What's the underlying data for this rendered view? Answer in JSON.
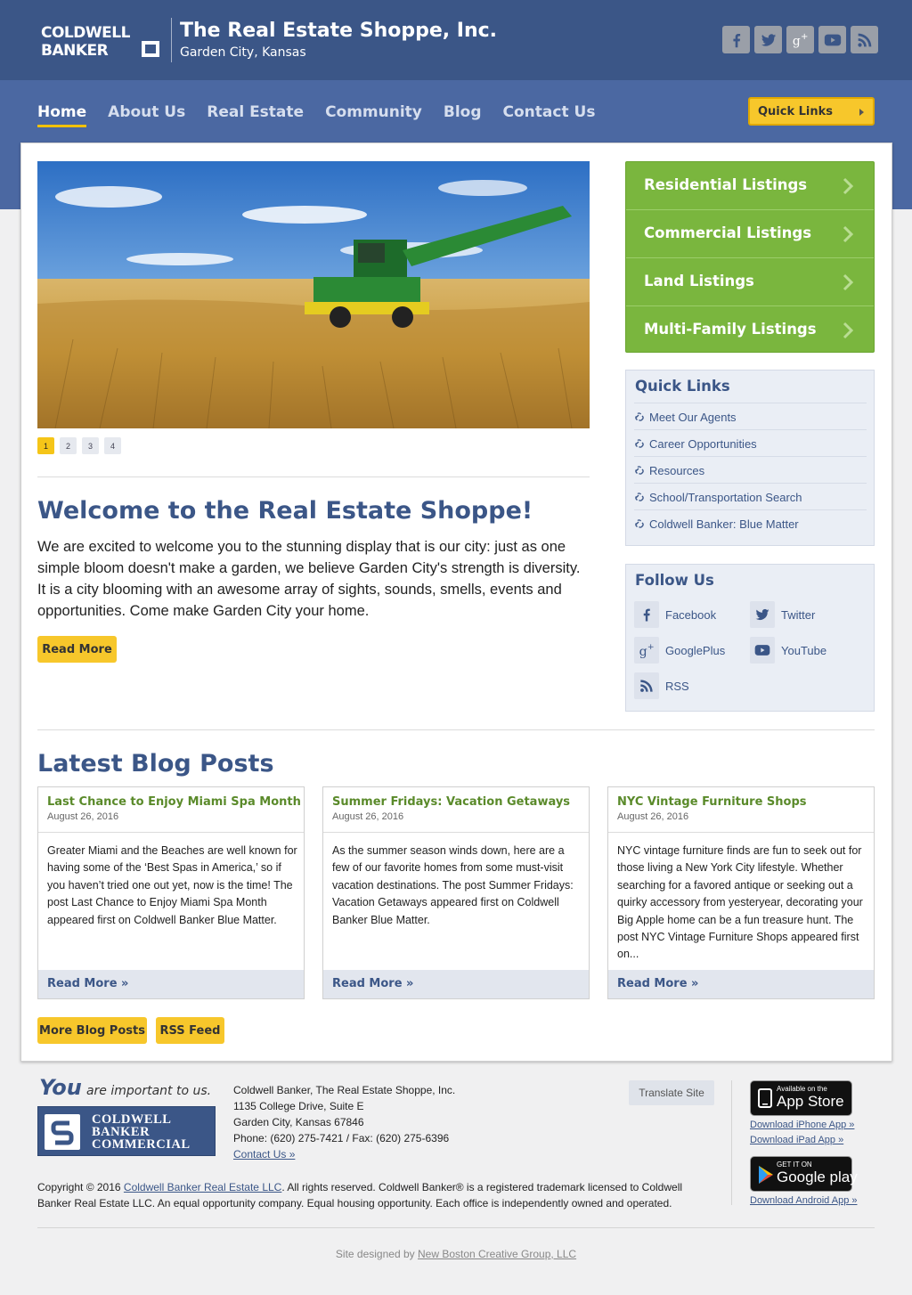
{
  "header": {
    "logo_text": "COLDWELL BANKER",
    "company_name": "The Real Estate Shoppe, Inc.",
    "city": "Garden City, Kansas",
    "social_icons": [
      "facebook-icon",
      "twitter-icon",
      "googleplus-icon",
      "youtube-icon",
      "rss-icon"
    ]
  },
  "nav": {
    "items": [
      {
        "label": "Home",
        "active": true
      },
      {
        "label": "About Us"
      },
      {
        "label": "Real Estate"
      },
      {
        "label": "Community"
      },
      {
        "label": "Blog"
      },
      {
        "label": "Contact Us"
      }
    ],
    "quick_links_button": "Quick Links"
  },
  "slider": {
    "dots": [
      "1",
      "2",
      "3",
      "4"
    ],
    "active_index": 0
  },
  "welcome": {
    "title": "Welcome to the Real Estate Shoppe!",
    "text": "We are excited to welcome you to the stunning display that is our city: just as one simple bloom doesn't make a garden, we believe Garden City's strength is diversity. It is a city blooming with an awesome array of sights, sounds, smells, events and opportunities. Come make Garden City your home.",
    "button": "Read More"
  },
  "listings": [
    "Residential Listings",
    "Commercial Listings",
    "Land Listings",
    "Multi-Family Listings"
  ],
  "quick_links": {
    "title": "Quick Links",
    "items": [
      "Meet Our Agents",
      "Career Opportunities",
      "Resources",
      "School/Transportation Search",
      "Coldwell Banker: Blue Matter"
    ]
  },
  "follow": {
    "title": "Follow Us",
    "items": [
      {
        "label": "Facebook",
        "icon": "facebook-icon"
      },
      {
        "label": "Twitter",
        "icon": "twitter-icon"
      },
      {
        "label": "GooglePlus",
        "icon": "googleplus-icon"
      },
      {
        "label": "YouTube",
        "icon": "youtube-icon"
      },
      {
        "label": "RSS",
        "icon": "rss-icon"
      }
    ]
  },
  "blog": {
    "title": "Latest Blog Posts",
    "posts": [
      {
        "title": "Last Chance to Enjoy Miami Spa Month",
        "date": "August 26, 2016",
        "excerpt": "Greater Miami and the Beaches are well known for having some of the ‘Best Spas in America,’ so if you haven’t tried one out yet, now is the time! The post Last Chance to Enjoy Miami Spa Month appeared first on Coldwell Banker Blue Matter.",
        "link": "Read More »"
      },
      {
        "title": "Summer Fridays: Vacation Getaways",
        "date": "August 26, 2016",
        "excerpt": "As the summer season winds down, here are a few of our favorite homes from some must-visit vacation destinations. The post Summer Fridays: Vacation Getaways appeared first on Coldwell Banker Blue Matter.",
        "link": "Read More »"
      },
      {
        "title": "NYC Vintage Furniture Shops",
        "date": "August 26, 2016",
        "excerpt": "NYC vintage furniture finds are fun to seek out for those living a New York City lifestyle. Whether searching for a favored antique or seeking out a quirky accessory from yesteryear, decorating your Big Apple home can be a fun treasure hunt. The post NYC Vintage Furniture Shops appeared first on...",
        "link": "Read More »"
      }
    ],
    "more_button": "More Blog Posts",
    "rss_button": "RSS Feed"
  },
  "footer": {
    "tagline_you": "You",
    "tagline_rest": "are important to us.",
    "cbc_logo_text": [
      "COLDWELL",
      "BANKER",
      "COMMERCIAL"
    ],
    "address_lines": [
      "Coldwell Banker, The Real Estate Shoppe, Inc.",
      "1135 College Drive, Suite E",
      "Garden City, Kansas 67846",
      "Phone: (620) 275-7421 / Fax: (620) 275-6396"
    ],
    "contact_link": "Contact Us »",
    "translate_button": "Translate Site",
    "app_store": {
      "small": "Available on the",
      "big": "App Store"
    },
    "google_play": {
      "small": "GET IT ON",
      "big": "Google play"
    },
    "iphone_link": "Download iPhone App »",
    "ipad_link": "Download iPad App »",
    "android_link": "Download Android App »",
    "copyright_prefix": "Copyright © 2016",
    "copyright_link": "Coldwell Banker Real Estate LLC",
    "copyright_suffix": ". All rights reserved. Coldwell Banker® is a registered trademark licensed to Coldwell Banker Real Estate LLC. An equal opportunity company. Equal housing opportunity. Each office is independently owned and operated.",
    "credits_prefix": "Site designed by",
    "credits_link": "New Boston Creative Group, LLC"
  },
  "colors": {
    "header_blue": "#3b5687",
    "nav_blue": "#4b68a2",
    "listing_green": "#7ab63e",
    "button_yellow": "#f7c72b",
    "link_blue": "#3b5687"
  }
}
